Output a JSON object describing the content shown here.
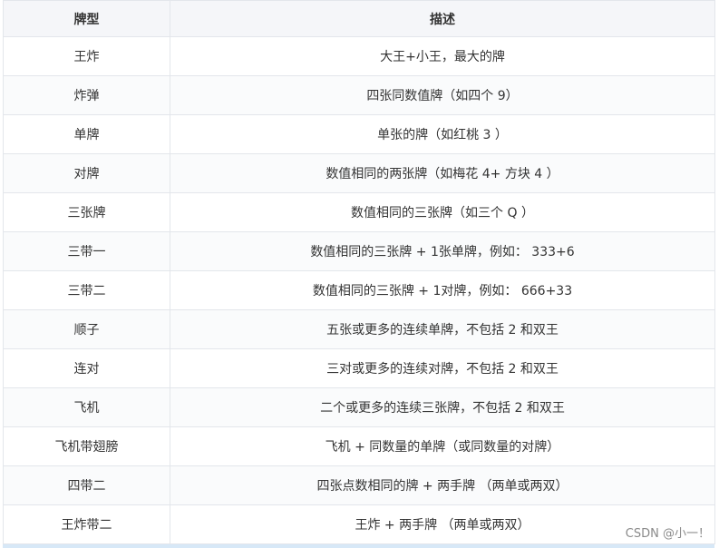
{
  "table": {
    "headers": [
      "牌型",
      "描述"
    ],
    "rows": [
      [
        "王炸",
        "大王+小王，最大的牌"
      ],
      [
        "炸弹",
        "四张同数值牌（如四个 9）"
      ],
      [
        "单牌",
        "单张的牌（如红桃 3 ）"
      ],
      [
        "对牌",
        "数值相同的两张牌（如梅花 4+ 方块 4 ）"
      ],
      [
        "三张牌",
        "数值相同的三张牌（如三个 Q ）"
      ],
      [
        "三带一",
        "数值相同的三张牌 + 1张单牌，例如： 333+6"
      ],
      [
        "三带二",
        "数值相同的三张牌 + 1对牌，例如： 666+33"
      ],
      [
        "顺子",
        "五张或更多的连续单牌，不包括 2 和双王"
      ],
      [
        "连对",
        "三对或更多的连续对牌，不包括 2 和双王"
      ],
      [
        "飞机",
        "二个或更多的连续三张牌，不包括 2 和双王"
      ],
      [
        "飞机带翅膀",
        "飞机 + 同数量的单牌（或同数量的对牌）"
      ],
      [
        "四带二",
        "四张点数相同的牌 + 两手牌 （两单或两双）"
      ],
      [
        "王炸带二",
        "王炸 + 两手牌 （两单或两双）"
      ]
    ]
  },
  "watermark": "CSDN @小一！"
}
